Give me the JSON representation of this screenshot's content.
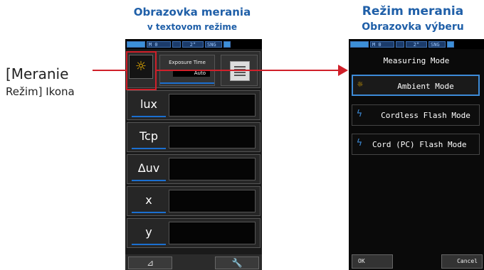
{
  "captions": {
    "left_title": "Obrazovka merania",
    "left_subtitle": "v textovom režime",
    "right_title": "Režim merania",
    "right_subtitle": "Obrazovka výberu"
  },
  "side_label": {
    "line1": "[Meranie",
    "line2": "Režim] Ikona"
  },
  "status_bar": {
    "memory": "M 0",
    "angle": "2°",
    "mode": "SNG"
  },
  "left_screen": {
    "exposure_title": "Exposure Time",
    "exposure_value": "Auto",
    "rows": [
      "lux",
      "Tcp",
      "Δuv",
      "x",
      "y"
    ],
    "bottom_left": "⊿",
    "bottom_right": "🔧"
  },
  "right_screen": {
    "title": "Measuring Mode",
    "items": [
      {
        "label": "Ambient Mode",
        "icon": "sun-icon",
        "selected": true
      },
      {
        "label": "Cordless Flash Mode",
        "icon": "flash-icon",
        "selected": false
      },
      {
        "label": "Cord (PC) Flash Mode",
        "icon": "flash-cord-icon",
        "selected": false
      }
    ],
    "ok": "OK",
    "cancel": "Cancel"
  },
  "colors": {
    "accent": "#1f5fa8",
    "highlight": "#d0202a",
    "selection": "#3d8bd8",
    "sun": "#f0b400",
    "flash": "#3d8bd8"
  }
}
